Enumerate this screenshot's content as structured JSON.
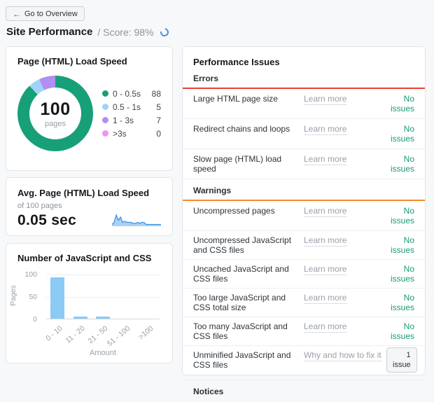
{
  "header": {
    "back_label": "Go to Overview",
    "title": "Site Performance",
    "score_label": "/ Score: 98%"
  },
  "cards": {
    "load_speed": {
      "title": "Page (HTML) Load Speed",
      "center_value": "100",
      "center_label": "pages"
    },
    "avg_speed": {
      "title": "Avg. Page (HTML) Load Speed",
      "subtitle": "of 100 pages",
      "value": "0.05 sec"
    },
    "js_css": {
      "title": "Number of JavaScript and CSS"
    }
  },
  "chart_data": [
    {
      "type": "pie",
      "donut": true,
      "title": "Page (HTML) Load Speed",
      "center_label": "100 pages",
      "legend_position": "right",
      "labels": [
        "0 - 0.5s",
        "0.5 - 1s",
        "1 - 3s",
        ">3s"
      ],
      "values": [
        88,
        5,
        7,
        0
      ],
      "colors": [
        "#17a078",
        "#9fd4f8",
        "#b18ef2",
        "#f094ec"
      ]
    },
    {
      "type": "bar",
      "title": "Number of JavaScript and CSS",
      "categories": [
        "0 - 10",
        "11 - 20",
        "21 - 50",
        "51 - 100",
        ">100"
      ],
      "values": [
        93,
        4,
        4,
        0,
        0
      ],
      "xlabel": "Amount",
      "ylabel": "Pages",
      "ylim": [
        0,
        100
      ],
      "yticks": [
        0,
        50,
        100
      ],
      "grid": true,
      "bar_color": "#8ccaf6"
    },
    {
      "type": "area",
      "title": "Avg. Page (HTML) Load Speed trend sparkline",
      "values": [
        1,
        3,
        10,
        5,
        8,
        3,
        4,
        3,
        3,
        3,
        2,
        2,
        3,
        2,
        3,
        3,
        1,
        1,
        1,
        1,
        1,
        1,
        1,
        1
      ],
      "color": "#3f93e8"
    }
  ],
  "issues": {
    "title": "Performance Issues",
    "sections": [
      {
        "name": "Errors",
        "color": "#e84135",
        "rows": [
          {
            "label": "Large HTML page size",
            "link": "Learn more",
            "status": "No issues",
            "status_type": "ok"
          },
          {
            "label": "Redirect chains and loops",
            "link": "Learn more",
            "status": "No issues",
            "status_type": "ok"
          },
          {
            "label": "Slow page (HTML) load speed",
            "link": "Learn more",
            "status": "No issues",
            "status_type": "ok"
          }
        ]
      },
      {
        "name": "Warnings",
        "color": "#f28b30",
        "rows": [
          {
            "label": "Uncompressed pages",
            "link": "Learn more",
            "status": "No issues",
            "status_type": "ok"
          },
          {
            "label": "Uncompressed JavaScript and CSS files",
            "link": "Learn more",
            "status": "No issues",
            "status_type": "ok"
          },
          {
            "label": "Uncached JavaScript and CSS files",
            "link": "Learn more",
            "status": "No issues",
            "status_type": "ok"
          },
          {
            "label": "Too large JavaScript and CSS total size",
            "link": "Learn more",
            "status": "No issues",
            "status_type": "ok"
          },
          {
            "label": "Too many JavaScript and CSS files",
            "link": "Learn more",
            "status": "No issues",
            "status_type": "ok"
          },
          {
            "label": "Unminified JavaScript and CSS files",
            "link": "Why and how to fix it",
            "status": "1 issue",
            "status_type": "button"
          }
        ]
      },
      {
        "name": "Notices",
        "color": null,
        "rows": []
      }
    ]
  },
  "colors": {
    "accent_blue": "#4a90e2",
    "error_red": "#e84135",
    "warning_orange": "#f28b30",
    "ok_green": "#189a78",
    "bar_blue": "#8ccaf6",
    "sparkline_blue": "#3f93e8"
  }
}
